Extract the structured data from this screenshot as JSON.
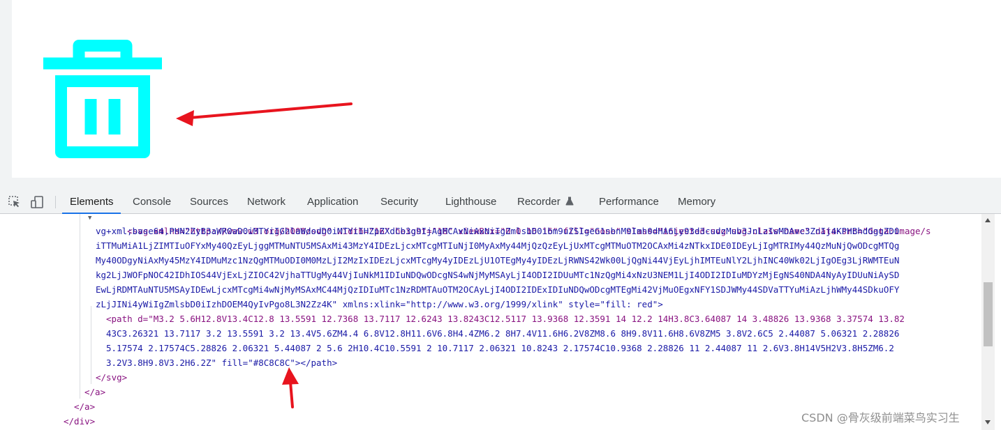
{
  "colors": {
    "icon": "#00ffff",
    "annotation_arrow": "#e8141e",
    "active_tab_underline": "#1a73e8",
    "tag": "#881280",
    "attr_name": "#994500",
    "attr_value": "#1a1aa6"
  },
  "preview": {
    "icon_name": "trash-icon"
  },
  "devtools": {
    "toolbar": {
      "inspect_icon": "select-element-icon",
      "device_icon": "device-toolbar-icon"
    },
    "tabs": [
      "Elements",
      "Console",
      "Sources",
      "Network",
      "Application",
      "Security",
      "Lighthouse",
      "Recorder",
      "Performance",
      "Memory"
    ],
    "recorder_icon": "flask-icon",
    "code_lines": [
      "<svg xmlns=\"http://www.w3.org/2000/svg\" width=\"16\" height=\"16\" viewBox=\"0 0 16 16\" fill=\"none\" class=\"injected-svg svg-class-name\" data-src=\"data:image/s",
      "vg+xml;base64,PHN2ZyB3aWR0aD0iMTYiIGhlaWdodD0iMTYiIHZpZXdCb3g9IjAgMCAxNiAxNiIgZmlsbD0ibm9uZSIgeG1sbnM9Imh0dHA6Ly93d3cudzMub3JnLzIwMDAvc3ZnIj4KPHBhdGggZD0",
      "iTTMuMiA1LjZIMTIuOFYxMy40QzEyLjggMTMuNTU5MSAxMi43MzY4IDEzLjcxMTcgMTIuNjI0MyAxMy44MjQzQzEyLjUxMTcgMTMuOTM2OCAxMi4zNTkxIDE0IDEyLjIgMTRIMy44QzMuNjQwODcgMTQg",
      "My40ODgyNiAxMy45MzY4IDMuMzc1NzQgMTMuODI0M0MzLjI2MzIxIDEzLjcxMTcgMy4yIDEzLjU1OTEgMy4yIDEzLjRWNS42Wk00LjQgNi44VjEyLjhIMTEuNlY2LjhINC40Wk02LjIgOEg3LjRWMTEuN",
      "kg2LjJWOFpNOC42IDhIOS44VjExLjZIOC42VjhaTTUgMy44VjIuNkM1IDIuNDQwODcgNS4wNjMyMSAyLjI4ODI2IDUuMTc1NzQgMi4xNzU3NEM1LjI4ODI2IDIuMDYzMjEgNS40NDA4NyAyIDUuNiAySD",
      "EwLjRDMTAuNTU5MSAyIDEwLjcxMTcgMi4wNjMyMSAxMC44MjQzIDIuMTc1NzRDMTAuOTM2OCAyLjI4ODI2IDExIDIuNDQwODcgMTEgMi42VjMuOEgxNFY1SDJWMy44SDVaTTYuMiAzLjhWMy44SDkuOFY",
      "zLjJINi4yWiIgZmlsbD0iIzhDOEM4QyIvPgo8L3N2Zz4K\" xmlns:xlink=\"http://www.w3.org/1999/xlink\" style=\"fill: red\">",
      "<path d=\"M3.2 5.6H12.8V13.4C12.8 13.5591 12.7368 13.7117 12.6243 13.8243C12.5117 13.9368 12.3591 14 12.2 14H3.8C3.64087 14 3.48826 13.9368 3.37574 13.82",
      "43C3.26321 13.7117 3.2 13.5591 3.2 13.4V5.6ZM4.4 6.8V12.8H11.6V6.8H4.4ZM6.2 8H7.4V11.6H6.2V8ZM8.6 8H9.8V11.6H8.6V8ZM5 3.8V2.6C5 2.44087 5.06321 2.28826",
      "5.17574 2.17574C5.28826 2.06321 5.44087 2 5.6 2H10.4C10.5591 2 10.7117 2.06321 10.8243 2.17574C10.9368 2.28826 11 2.44087 11 2.6V3.8H14V5H2V3.8H5ZM6.2",
      "3.2V3.8H9.8V3.2H6.2Z\" fill=\"#8C8C8C\"></path>",
      "</svg>",
      "</a>",
      "</a>",
      "</div>"
    ]
  },
  "watermark": "CSDN @骨灰级前端菜鸟实习生"
}
